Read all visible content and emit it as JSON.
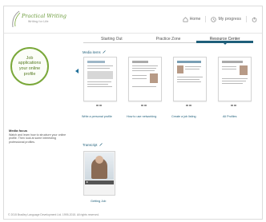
{
  "brand": {
    "title": "Practical Writing",
    "subtitle": "Writing for Life"
  },
  "topnav": {
    "home_label": "Home",
    "progress_label": "My progress"
  },
  "badge": {
    "text": "Job applications your online profile"
  },
  "sidebar": {
    "media_title": "Media focus",
    "media_desc": "Watch and learn how to structure your online profile. Then look at some interesting professional profiles."
  },
  "tabs": [
    {
      "label": "Starting Out",
      "active": false
    },
    {
      "label": "Practice Zone",
      "active": false
    },
    {
      "label": "Resource Center",
      "active": true
    }
  ],
  "sections": {
    "media_items_title": "Media items",
    "video_title": "Transcript"
  },
  "thumbnails": [
    {
      "label": "Write a personal profile"
    },
    {
      "label": "How to use networking"
    },
    {
      "label": "Create a job listing"
    },
    {
      "label": "All Profiles"
    }
  ],
  "video": {
    "label": "Getting Job"
  },
  "footer": {
    "copyright": "© 2015 Bradley Language Development Ltd. 1995-2015. All rights reserved."
  },
  "colors": {
    "accent_green": "#7aa83a",
    "accent_blue": "#1f5f7a"
  }
}
